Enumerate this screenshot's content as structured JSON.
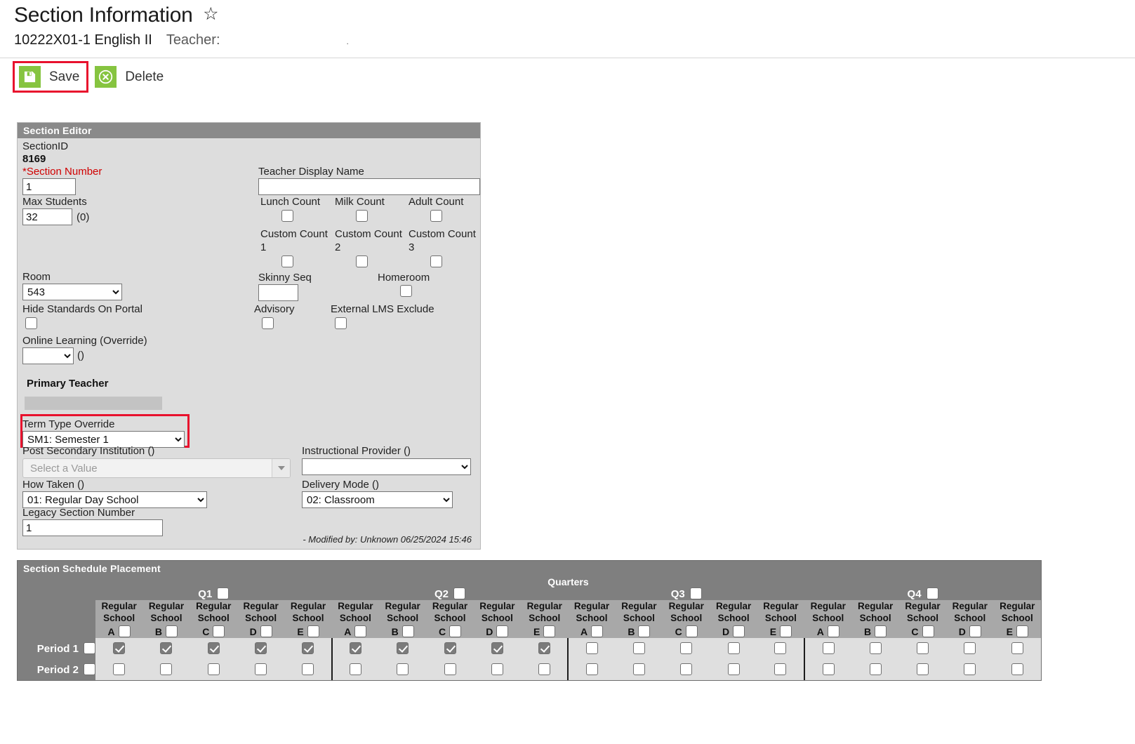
{
  "header": {
    "title": "Section Information",
    "star_icon": "star-outline-icon",
    "course_code": "10222X01-1 English II",
    "teacher_label": "Teacher:",
    "teacher_value": "."
  },
  "toolbar": {
    "save_label": "Save",
    "save_icon": "floppy-disk-icon",
    "delete_label": "Delete",
    "delete_icon": "x-circle-icon",
    "highlight_color": "#e8112d",
    "icon_color": "#86c440"
  },
  "section_editor": {
    "card_title": "Section Editor",
    "section_id_label": "SectionID",
    "section_id_value": "8169",
    "section_number_label": "*Section Number",
    "section_number_value": "1",
    "max_students_label": "Max Students",
    "max_students_value": "32",
    "max_students_suffix": "(0)",
    "room_label": "Room",
    "room_value": "543",
    "hide_standards_label": "Hide Standards On Portal",
    "online_learning_label": "Online Learning (Override)",
    "online_learning_value": "",
    "online_learning_suffix": "()",
    "primary_teacher_label": "Primary Teacher",
    "teacher_display_name_label": "Teacher Display Name",
    "teacher_display_name_value": "",
    "lunch_count_label": "Lunch Count",
    "milk_count_label": "Milk Count",
    "adult_count_label": "Adult Count",
    "custom_count_1_label": "Custom Count 1",
    "custom_count_2_label": "Custom Count 2",
    "custom_count_3_label": "Custom Count 3",
    "skinny_seq_label": "Skinny Seq",
    "skinny_seq_value": "",
    "homeroom_label": "Homeroom",
    "advisory_label": "Advisory",
    "external_lms_label": "External LMS Exclude",
    "term_type_override_label": "Term Type Override",
    "term_type_override_value": "SM1: Semester 1",
    "post_secondary_label": "Post Secondary Institution ()",
    "post_secondary_placeholder": "Select a Value",
    "instructional_provider_label": "Instructional Provider ()",
    "instructional_provider_value": "",
    "how_taken_label": "How Taken ()",
    "how_taken_value": "01: Regular Day School",
    "delivery_mode_label": "Delivery Mode ()",
    "delivery_mode_value": "02: Classroom",
    "legacy_section_label": "Legacy Section Number",
    "legacy_section_value": "1",
    "modified_by": "- Modified by: Unknown 06/25/2024 15:46"
  },
  "placement": {
    "card_title": "Section Schedule Placement",
    "quarters_label": "Quarters",
    "quarters": [
      {
        "label": "Q1",
        "checked": false,
        "columns": [
          {
            "name": "Regular School",
            "letter": "A",
            "header_checked": false
          },
          {
            "name": "Regular School",
            "letter": "B",
            "header_checked": false
          },
          {
            "name": "Regular School",
            "letter": "C",
            "header_checked": false
          },
          {
            "name": "Regular School",
            "letter": "D",
            "header_checked": false
          },
          {
            "name": "Regular School",
            "letter": "E",
            "header_checked": false
          }
        ]
      },
      {
        "label": "Q2",
        "checked": false,
        "columns": [
          {
            "name": "Regular School",
            "letter": "A",
            "header_checked": false
          },
          {
            "name": "Regular School",
            "letter": "B",
            "header_checked": false
          },
          {
            "name": "Regular School",
            "letter": "C",
            "header_checked": false
          },
          {
            "name": "Regular School",
            "letter": "D",
            "header_checked": false
          },
          {
            "name": "Regular School",
            "letter": "E",
            "header_checked": false
          }
        ]
      },
      {
        "label": "Q3",
        "checked": false,
        "columns": [
          {
            "name": "Regular School",
            "letter": "A",
            "header_checked": false
          },
          {
            "name": "Regular School",
            "letter": "B",
            "header_checked": false
          },
          {
            "name": "Regular School",
            "letter": "C",
            "header_checked": false
          },
          {
            "name": "Regular School",
            "letter": "D",
            "header_checked": false
          },
          {
            "name": "Regular School",
            "letter": "E",
            "header_checked": false
          }
        ]
      },
      {
        "label": "Q4",
        "checked": false,
        "columns": [
          {
            "name": "Regular School",
            "letter": "A",
            "header_checked": false
          },
          {
            "name": "Regular School",
            "letter": "B",
            "header_checked": false
          },
          {
            "name": "Regular School",
            "letter": "C",
            "header_checked": false
          },
          {
            "name": "Regular School",
            "letter": "D",
            "header_checked": false
          },
          {
            "name": "Regular School",
            "letter": "E",
            "header_checked": false
          }
        ]
      }
    ],
    "rows": [
      {
        "label": "Period 1",
        "row_checked": false,
        "cells": [
          true,
          true,
          true,
          true,
          true,
          true,
          true,
          true,
          true,
          true,
          false,
          false,
          false,
          false,
          false,
          false,
          false,
          false,
          false,
          false
        ]
      },
      {
        "label": "Period 2",
        "row_checked": false,
        "cells": [
          false,
          false,
          false,
          false,
          false,
          false,
          false,
          false,
          false,
          false,
          false,
          false,
          false,
          false,
          false,
          false,
          false,
          false,
          false,
          false
        ]
      }
    ]
  }
}
